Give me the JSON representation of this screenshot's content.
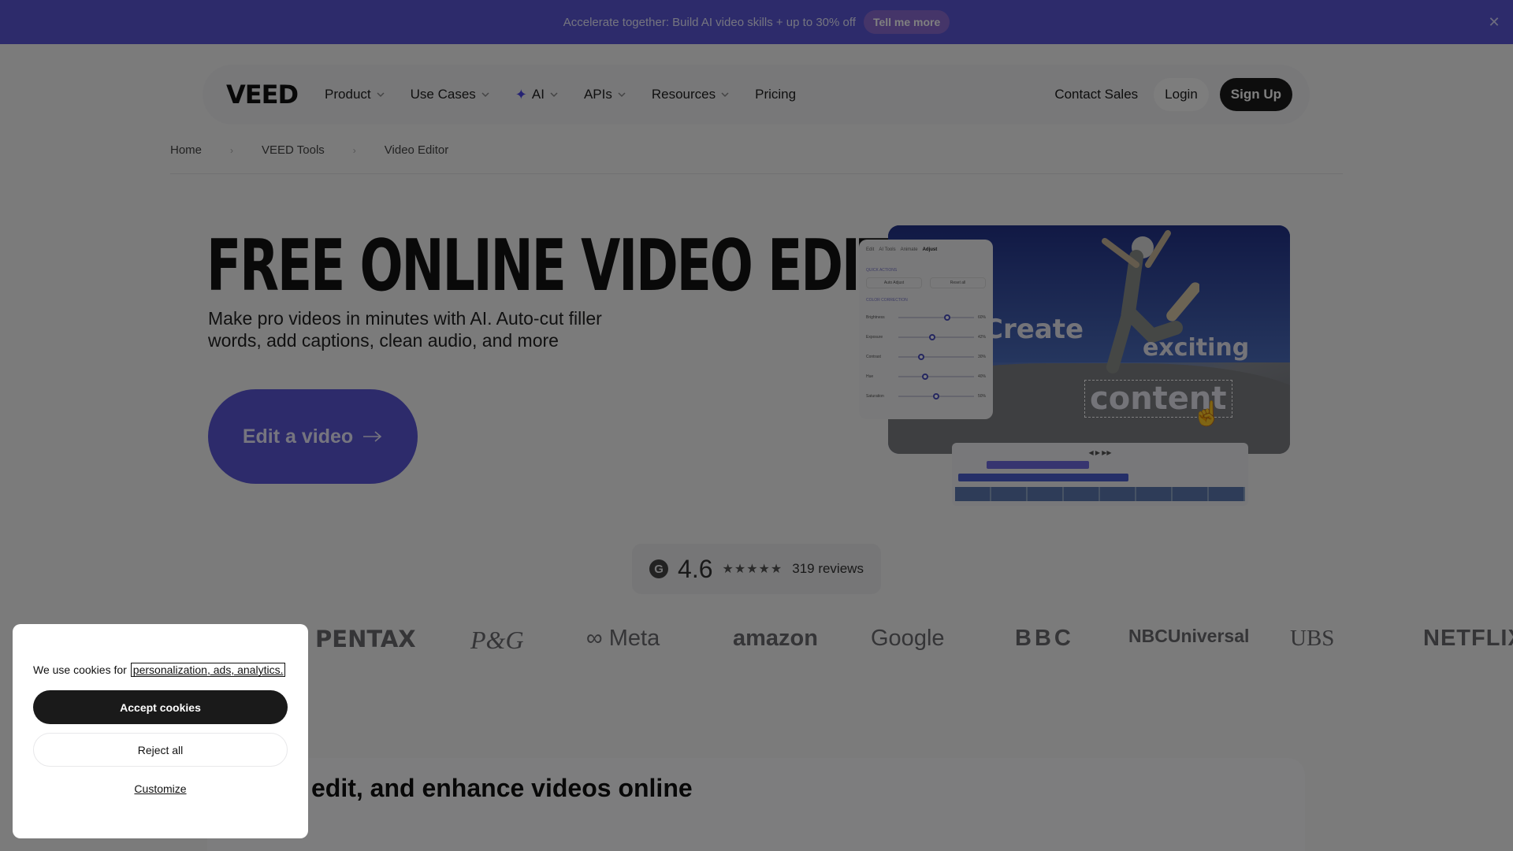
{
  "announcement": {
    "text": "Accelerate together: Build AI video skills + up to 30% off",
    "cta": "Tell me more",
    "close_icon": "close-icon"
  },
  "nav": {
    "logo": "VEED",
    "items": [
      {
        "label": "Product",
        "caret": true
      },
      {
        "label": "Use Cases",
        "caret": true
      },
      {
        "label": "AI",
        "caret": true,
        "icon": "sparkle-icon"
      },
      {
        "label": "APIs",
        "caret": true
      },
      {
        "label": "Resources",
        "caret": true
      },
      {
        "label": "Pricing",
        "caret": false
      }
    ],
    "contact": "Contact Sales",
    "login": "Login",
    "signup": "Sign Up"
  },
  "breadcrumb": [
    "Home",
    "VEED Tools",
    "Video Editor"
  ],
  "hero": {
    "title": "FREE ONLINE VIDEO EDITOR",
    "subtitle": "Make pro videos in minutes with AI. Auto-cut filler words, add captions, clean audio, and more",
    "cta": "Edit a video",
    "overlay_words": [
      "Create",
      "exciting",
      "content"
    ],
    "panel": {
      "tabs": [
        "Edit",
        "AI Tools",
        "Animate",
        "Adjust"
      ],
      "quick_actions_label": "QUICK ACTIONS",
      "quick_actions": [
        "Auto Adjust",
        "Reset all"
      ],
      "color_label": "COLOR CORRECTION",
      "sliders": [
        {
          "label": "Brightness",
          "value": 0.65,
          "text": "60%"
        },
        {
          "label": "Exposure",
          "value": 0.45,
          "text": "42%"
        },
        {
          "label": "Contrast",
          "value": 0.3,
          "text": "30%"
        },
        {
          "label": "Hue",
          "value": 0.35,
          "text": "40%"
        },
        {
          "label": "Saturation",
          "value": 0.5,
          "text": "50%"
        }
      ]
    }
  },
  "rating": {
    "icon": "g2-icon",
    "score": "4.6",
    "stars": "★★★★★",
    "reviews": "319 reviews"
  },
  "brands": [
    "PENTAX",
    "P&G",
    "∞ Meta",
    "amazon",
    "Google",
    "BBC",
    "NBCUniversal",
    "UBS",
    "NETFLIX"
  ],
  "section": {
    "title": "edit, and enhance videos online"
  },
  "cookie": {
    "message": "We use cookies for",
    "link": "personalization, ads, analytics.",
    "accept": "Accept cookies",
    "reject": "Reject all",
    "customize": "Customize"
  },
  "colors": {
    "accent": "#5b57d6",
    "dark": "#1a1a1a",
    "overlay": "rgba(0,0,0,0.5)"
  }
}
